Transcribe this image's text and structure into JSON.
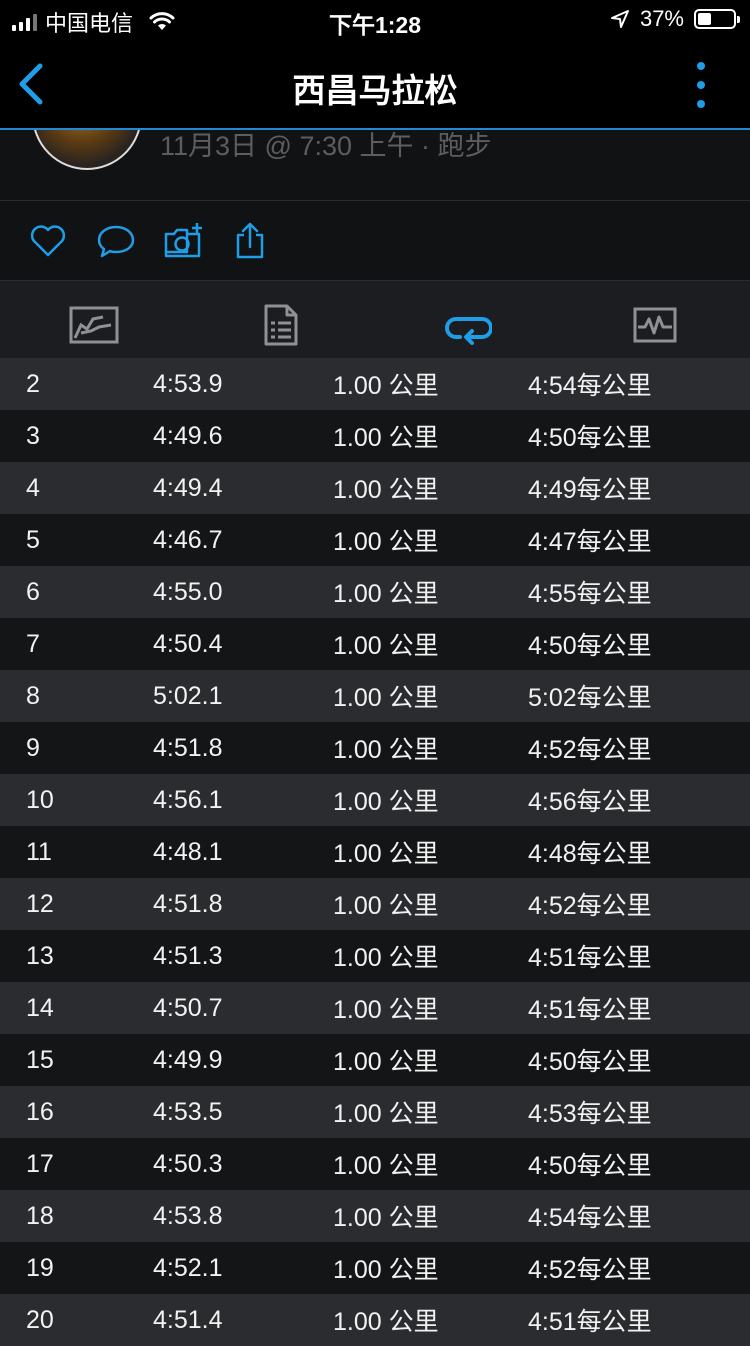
{
  "status_bar": {
    "carrier": "中国电信",
    "time": "下午1:28",
    "battery": "37%",
    "battery_level": 0.37
  },
  "nav": {
    "title": "西昌马拉松"
  },
  "activity": {
    "meta": "11月3日 @ 7:30 上午 · 跑步"
  },
  "colors": {
    "accent": "#1f9de6",
    "row_odd": "#2b2c2f",
    "row_even": "#141517"
  },
  "icons": [
    "heart-icon",
    "comment-icon",
    "camera-add-icon",
    "share-icon",
    "map-tab-icon",
    "details-tab-icon",
    "laps-tab-icon",
    "chart-tab-icon"
  ],
  "laps": [
    {
      "lap": "2",
      "time": "4:53.9",
      "distance": "1.00 公里",
      "pace": "4:54每公里"
    },
    {
      "lap": "3",
      "time": "4:49.6",
      "distance": "1.00 公里",
      "pace": "4:50每公里"
    },
    {
      "lap": "4",
      "time": "4:49.4",
      "distance": "1.00 公里",
      "pace": "4:49每公里"
    },
    {
      "lap": "5",
      "time": "4:46.7",
      "distance": "1.00 公里",
      "pace": "4:47每公里"
    },
    {
      "lap": "6",
      "time": "4:55.0",
      "distance": "1.00 公里",
      "pace": "4:55每公里"
    },
    {
      "lap": "7",
      "time": "4:50.4",
      "distance": "1.00 公里",
      "pace": "4:50每公里"
    },
    {
      "lap": "8",
      "time": "5:02.1",
      "distance": "1.00 公里",
      "pace": "5:02每公里"
    },
    {
      "lap": "9",
      "time": "4:51.8",
      "distance": "1.00 公里",
      "pace": "4:52每公里"
    },
    {
      "lap": "10",
      "time": "4:56.1",
      "distance": "1.00 公里",
      "pace": "4:56每公里"
    },
    {
      "lap": "11",
      "time": "4:48.1",
      "distance": "1.00 公里",
      "pace": "4:48每公里"
    },
    {
      "lap": "12",
      "time": "4:51.8",
      "distance": "1.00 公里",
      "pace": "4:52每公里"
    },
    {
      "lap": "13",
      "time": "4:51.3",
      "distance": "1.00 公里",
      "pace": "4:51每公里"
    },
    {
      "lap": "14",
      "time": "4:50.7",
      "distance": "1.00 公里",
      "pace": "4:51每公里"
    },
    {
      "lap": "15",
      "time": "4:49.9",
      "distance": "1.00 公里",
      "pace": "4:50每公里"
    },
    {
      "lap": "16",
      "time": "4:53.5",
      "distance": "1.00 公里",
      "pace": "4:53每公里"
    },
    {
      "lap": "17",
      "time": "4:50.3",
      "distance": "1.00 公里",
      "pace": "4:50每公里"
    },
    {
      "lap": "18",
      "time": "4:53.8",
      "distance": "1.00 公里",
      "pace": "4:54每公里"
    },
    {
      "lap": "19",
      "time": "4:52.1",
      "distance": "1.00 公里",
      "pace": "4:52每公里"
    },
    {
      "lap": "20",
      "time": "4:51.4",
      "distance": "1.00 公里",
      "pace": "4:51每公里"
    }
  ]
}
